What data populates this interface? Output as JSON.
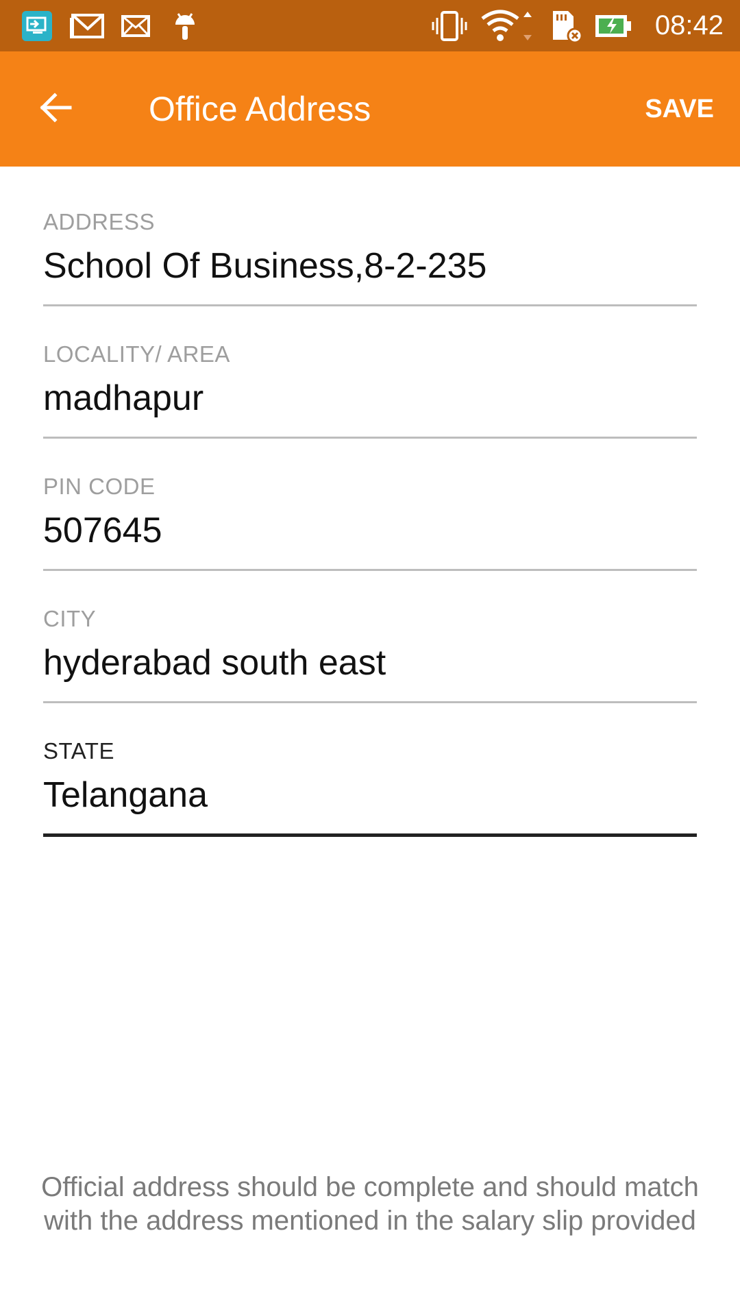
{
  "status_bar": {
    "time": "08:42",
    "left_icons": [
      "screen-share-icon",
      "gmail-icon",
      "mail-icon",
      "android-debug-icon"
    ],
    "right_icons": [
      "vibrate-icon",
      "wifi-icon",
      "sd-card-icon",
      "battery-charging-icon"
    ]
  },
  "app_bar": {
    "title": "Office Address",
    "save_label": "SAVE",
    "back_icon": "arrow-back-icon",
    "background_color": "#f58216"
  },
  "form": {
    "fields": [
      {
        "label": "ADDRESS",
        "value": "School Of Business,8-2-235"
      },
      {
        "label": "LOCALITY/ AREA",
        "value": "madhapur"
      },
      {
        "label": "PIN CODE",
        "value": "507645"
      },
      {
        "label": "CITY",
        "value": "hyderabad south east"
      },
      {
        "label": "STATE",
        "value": "Telangana",
        "focused": true
      }
    ]
  },
  "footer": {
    "note": "Official address should be complete and should match with the address mentioned in the salary slip provided"
  }
}
